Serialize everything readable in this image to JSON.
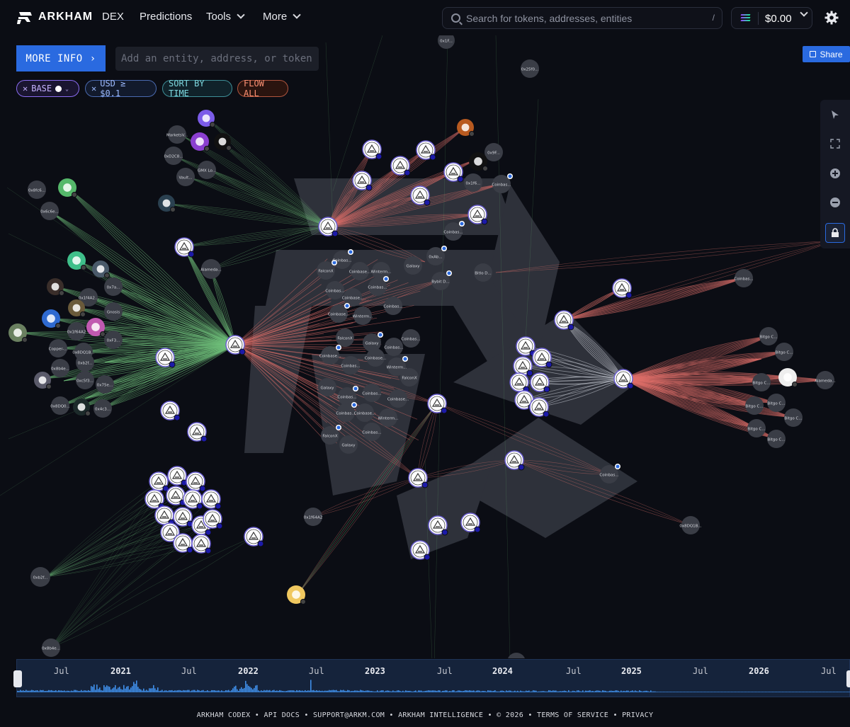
{
  "brand": {
    "name": "ARKHAM"
  },
  "nav": {
    "dex": "DEX",
    "predictions": "Predictions",
    "tools": "Tools",
    "more": "More"
  },
  "search": {
    "placeholder": "Search for tokens, addresses, entities",
    "shortcut": "/"
  },
  "wallet": {
    "balance": "$0.00"
  },
  "toolbar": {
    "more_info": "MORE INFO",
    "entity_placeholder": "Add an entity, address, or token",
    "share": "Share",
    "filters": [
      {
        "label": "BASE",
        "color": "#b79bff"
      },
      {
        "label": "USD ≥ $0.1",
        "color": "#8fb4ff"
      },
      {
        "label": "SORT BY TIME",
        "color": "#6ad0d8"
      },
      {
        "label": "FLOW ALL",
        "color": "#ff8a6a"
      }
    ]
  },
  "graph": {
    "colors": {
      "inflow": "#6fc07a",
      "outflow": "#e0706a",
      "neutral": "#d0d4dc"
    },
    "labels": {
      "alameda_left": "Alameda...",
      "coinbase": "Coinbas...",
      "coinbase2": "Coinbase...",
      "alameda_right": "Alameda...",
      "bitgo": "Bitgo C...",
      "gmx": "GMX Lo...",
      "markets": "MarketsV...",
      "vault": "Vault...",
      "gnosis": "Gnosis",
      "copper": "Copper-...",
      "wintermute": "Winterm...",
      "falcon": "FalconX",
      "galaxy": "Galaxy",
      "bybit": "Bybit D...",
      "bitlo": "Bitlo D...",
      "x1": "0x8fc6...",
      "x2": "0x6c6e...",
      "x3": "0xD2C8...",
      "x4": "0x1f4A2...",
      "x5": "0x7a...",
      "x6": "0x8DQ1B...",
      "x7": "0xF3...",
      "x8": "0x1f64A2",
      "x9": "0xb2f...",
      "x10": "0x8b4e...",
      "x11": "0x75e...",
      "x12": "0xc5f3...",
      "x13": "0x8DQ0...",
      "x14": "0x4c3...",
      "x15": "0x1F...",
      "x16": "0x25f0...",
      "x17": "0x9F...",
      "x18": "0x1f6...",
      "x19": "0xAb..."
    }
  },
  "timeline": {
    "labels": [
      "Jul",
      "2021",
      "Jul",
      "2022",
      "Jul",
      "2023",
      "Jul",
      "2024",
      "Jul",
      "2025",
      "Jul",
      "2026",
      "Jul"
    ]
  },
  "footer": {
    "text": "ARKHAM CODEX • API DOCS • SUPPORT@ARKM.COM • ARKHAM INTELLIGENCE • © 2026 • TERMS OF SERVICE • PRIVACY"
  }
}
